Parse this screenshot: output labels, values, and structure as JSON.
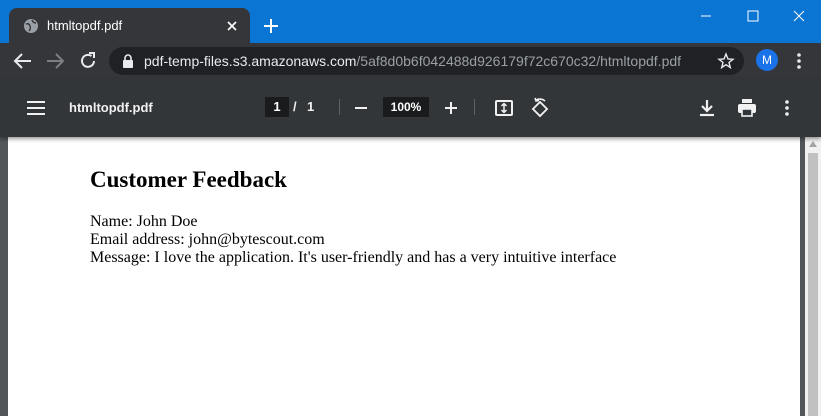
{
  "browser": {
    "tab_title": "htmltopdf.pdf",
    "url_host": "pdf-temp-files.s3.amazonaws.com",
    "url_path": "/5af8d0b6f042488d926179f72c670c32/htmltopdf.pdf",
    "profile_initial": "M"
  },
  "pdf_viewer": {
    "file_name": "htmltopdf.pdf",
    "current_page": "1",
    "page_separator": "/",
    "total_pages": "1",
    "zoom": "100%"
  },
  "document": {
    "heading": "Customer Feedback",
    "lines": [
      "Name: John Doe",
      "Email address: john@bytescout.com",
      "Message: I love the application. It's user-friendly and has a very intuitive interface"
    ]
  },
  "colors": {
    "titlebar": "#0a75d3",
    "tab_bg": "#35363a",
    "pdf_toolbar": "#323639",
    "viewer_bg": "#525659"
  }
}
